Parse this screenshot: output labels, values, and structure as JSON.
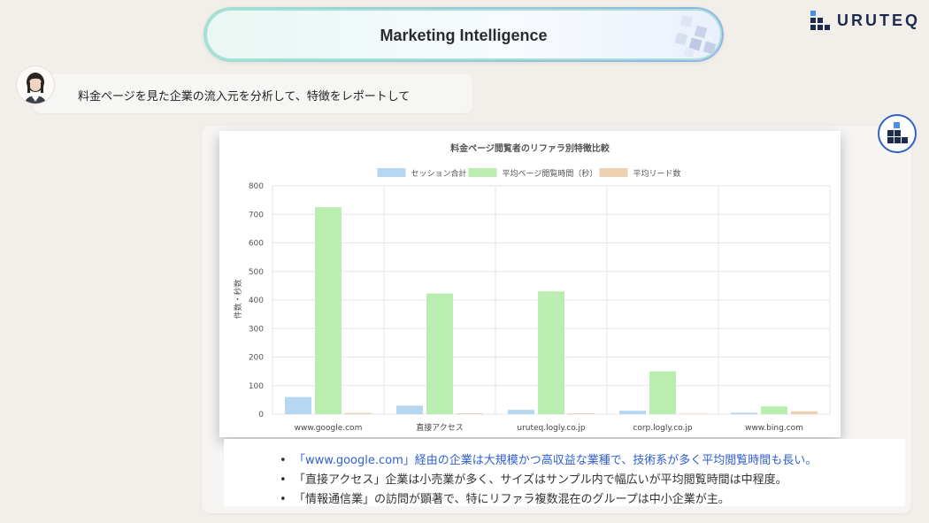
{
  "header": {
    "title": "Marketing Intelligence",
    "brand": "URUTEQ"
  },
  "user_message": {
    "text": "料金ページを見た企業の流入元を分析して、特徴をレポートして"
  },
  "chart_data": {
    "type": "bar",
    "title": "料金ページ閲覧者のリファラ別特徴比較",
    "ylabel": "件数・秒数",
    "xlabel": "",
    "ylim": [
      0,
      800
    ],
    "yticks": [
      0,
      100,
      200,
      300,
      400,
      500,
      600,
      700,
      800
    ],
    "grid": true,
    "legend_position": "top",
    "categories": [
      "www.google.com",
      "直接アクセス",
      "uruteq.logly.co.jp",
      "corp.logly.co.jp",
      "www.bing.com"
    ],
    "series": [
      {
        "name": "セッション合計",
        "color": "#b7d6f0",
        "values": [
          60,
          30,
          15,
          12,
          5
        ]
      },
      {
        "name": "平均ページ閲覧時間（秒）",
        "color": "#b9eeb0",
        "values": [
          725,
          423,
          430,
          150,
          27
        ]
      },
      {
        "name": "平均リード数",
        "color": "#ecd1b0",
        "values": [
          4,
          3,
          3,
          2,
          10
        ]
      }
    ]
  },
  "summary": {
    "bullets": [
      "「www.google.com」経由の企業は大規模かつ高収益な業種で、技術系が多く平均閲覧時間も長い。",
      "「直接アクセス」企業は小売業が多く、サイズはサンプル内で幅広いが平均閲覧時間は中程度。",
      "「情報通信業」の訪問が顕著で、特にリファラ複数混在のグループは中小企業が主。"
    ]
  },
  "colors": {
    "accent": "#2f61c9",
    "brand_navy": "#1d2b4f",
    "link_blue": "#2f5fd0"
  }
}
